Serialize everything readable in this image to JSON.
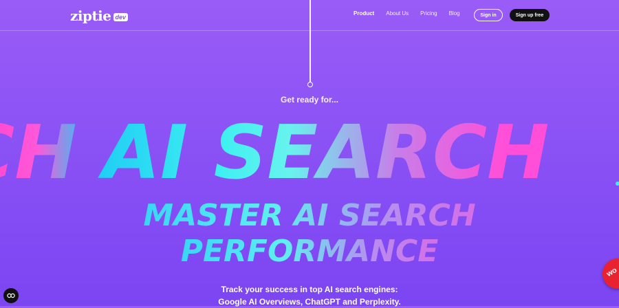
{
  "brand": {
    "name": "ziptie",
    "badge": "dev"
  },
  "nav": {
    "links": [
      {
        "label": "Product",
        "active": true
      },
      {
        "label": "About Us",
        "active": false
      },
      {
        "label": "Pricing",
        "active": false
      },
      {
        "label": "Blog",
        "active": false
      }
    ],
    "signin_label": "Sign in",
    "signup_label": "Sign up free"
  },
  "hero": {
    "kicker": "Get ready for...",
    "marquee": "CH AI SEARCH",
    "headline_line1": "MASTER AI SEARCH",
    "headline_line2": "PERFORMANCE",
    "sub_line1": "Track your success in top AI search engines:",
    "sub_line2": "Google AI Overviews, ChatGPT and Perplexity."
  },
  "widgets": {
    "cookie_icon": "cookie-settings-icon",
    "badge_text": "wo"
  },
  "colors": {
    "background": "#8b52f5",
    "accent_cyan": "#3ef0f0",
    "accent_pink": "#ff4fd8",
    "button_dark": "#111111",
    "badge_red": "#e8232f"
  }
}
